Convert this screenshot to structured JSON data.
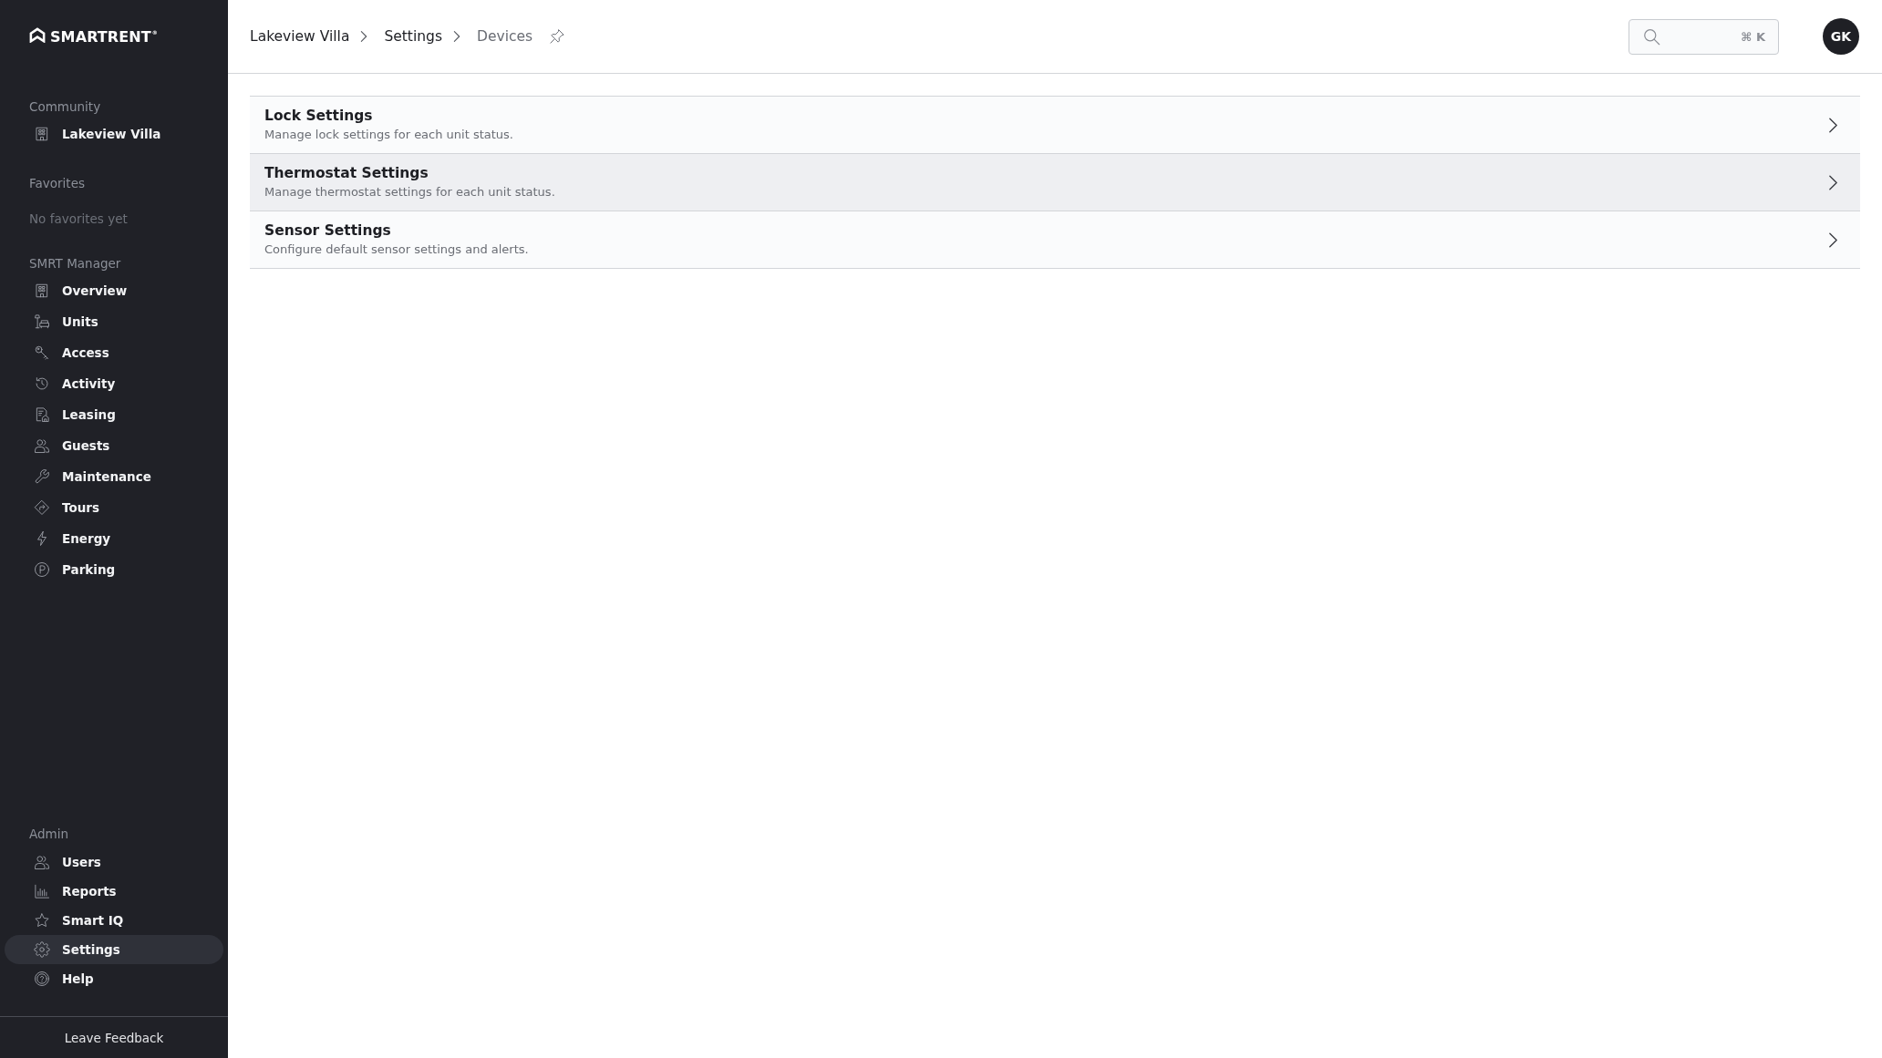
{
  "sidebar": {
    "logo": {
      "wordmark": "SMARTRENT$^{®}$"
    },
    "community": {
      "label": "Community",
      "items": [
        {
          "label": "Lakeview Villa"
        }
      ]
    },
    "favorites": {
      "label": "Favorites",
      "empty_text": "No favorites yet"
    },
    "manager": {
      "label": "SMRT Manager",
      "items": [
        {
          "label": "Overview",
          "selected": false
        },
        {
          "label": "Units",
          "selected": false
        },
        {
          "label": "Access",
          "selected": false
        },
        {
          "label": "Activity",
          "selected": false
        },
        {
          "label": "Leasing",
          "selected": false
        },
        {
          "label": "Guests",
          "selected": false
        },
        {
          "label": "Maintenance",
          "selected": false
        },
        {
          "label": "Tours",
          "selected": false
        },
        {
          "label": "Energy",
          "selected": false
        },
        {
          "label": "Parking",
          "selected": false
        }
      ]
    },
    "admin": {
      "label": "Admin",
      "items": [
        {
          "label": "Users",
          "selected": false
        },
        {
          "label": "Reports",
          "selected": false
        },
        {
          "label": "Smart IQ",
          "selected": false
        },
        {
          "label": "Settings",
          "selected": true
        },
        {
          "label": "Help",
          "selected": false
        }
      ]
    },
    "footer": {
      "button": "Leave Feedback"
    }
  },
  "header": {
    "breadcrumb": [
      {
        "label": "Lakeview Villa",
        "current": false
      },
      {
        "label": "Settings",
        "current": false
      },
      {
        "label": "Devices",
        "current": true
      }
    ],
    "search": {
      "shortcut": "⌘ K"
    },
    "avatar": {
      "initials": "GK"
    }
  },
  "settings_list": [
    {
      "title": "Lock Settings",
      "description": "Manage lock settings for each unit status.",
      "highlighted": false
    },
    {
      "title": "Thermostat Settings",
      "description": "Manage thermostat settings for each unit status.",
      "highlighted": true
    },
    {
      "title": "Sensor Settings",
      "description": "Configure default sensor settings and alerts.",
      "highlighted": false
    }
  ]
}
